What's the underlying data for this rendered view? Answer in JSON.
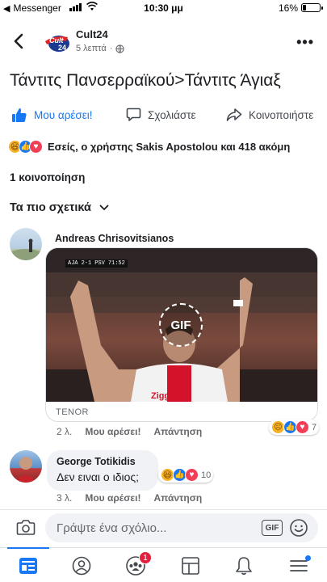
{
  "status_bar": {
    "app_back": "Messenger",
    "time": "10:30 μμ",
    "battery": "16%",
    "battery_level": 0.16
  },
  "header": {
    "page_name": "Cult24",
    "time_ago": "5 λεπτά",
    "privacy_icon": "globe-icon",
    "logo_text": "Cult24"
  },
  "post": {
    "title": "Τάντιτς Πανσερραϊκού>Τάντιτς Άγιαξ"
  },
  "actions": {
    "like": "Μου αρέσει!",
    "comment": "Σχολιάστε",
    "share": "Κοινοποιήστε"
  },
  "reactions_summary": {
    "icons": [
      "haha",
      "like",
      "love"
    ],
    "text": "Εσείς, ο χρήστης Sakis Apostolou και 418 ακόμη"
  },
  "shares": "1 κοινοποίηση",
  "sort": {
    "label": "Τα πιο σχετικά"
  },
  "comments": [
    {
      "author": "Andreas Chrisovitsianos",
      "gif": {
        "badge": "GIF",
        "source": "TENOR",
        "scorebug_team1": "AJA",
        "scorebug_score": "2-1",
        "scorebug_team2": "PSV",
        "scorebug_clock": "71:52"
      },
      "time": "2 λ.",
      "like": "Μου αρέσει!",
      "reply": "Απάντηση",
      "reaction_icons": [
        "sad",
        "like",
        "love"
      ],
      "reaction_count": "7"
    },
    {
      "author": "George Totikidis",
      "text": "Δεν ειναι ο ιδιος;",
      "time": "3 λ.",
      "like": "Μου αρέσει!",
      "reply": "Απάντηση",
      "reaction_icons": [
        "haha",
        "like",
        "love"
      ],
      "reaction_count": "10"
    }
  ],
  "composer": {
    "placeholder": "Γράψτε ένα σχόλιο...",
    "gif_label": "GIF"
  },
  "tabbar": {
    "tabs": [
      "news-feed",
      "profile",
      "groups",
      "pages",
      "notifications",
      "menu"
    ],
    "groups_badge": "1",
    "active": "news-feed"
  },
  "colors": {
    "accent": "#1877f2",
    "badge": "#e41e3f",
    "secondary_text": "#65676b"
  }
}
